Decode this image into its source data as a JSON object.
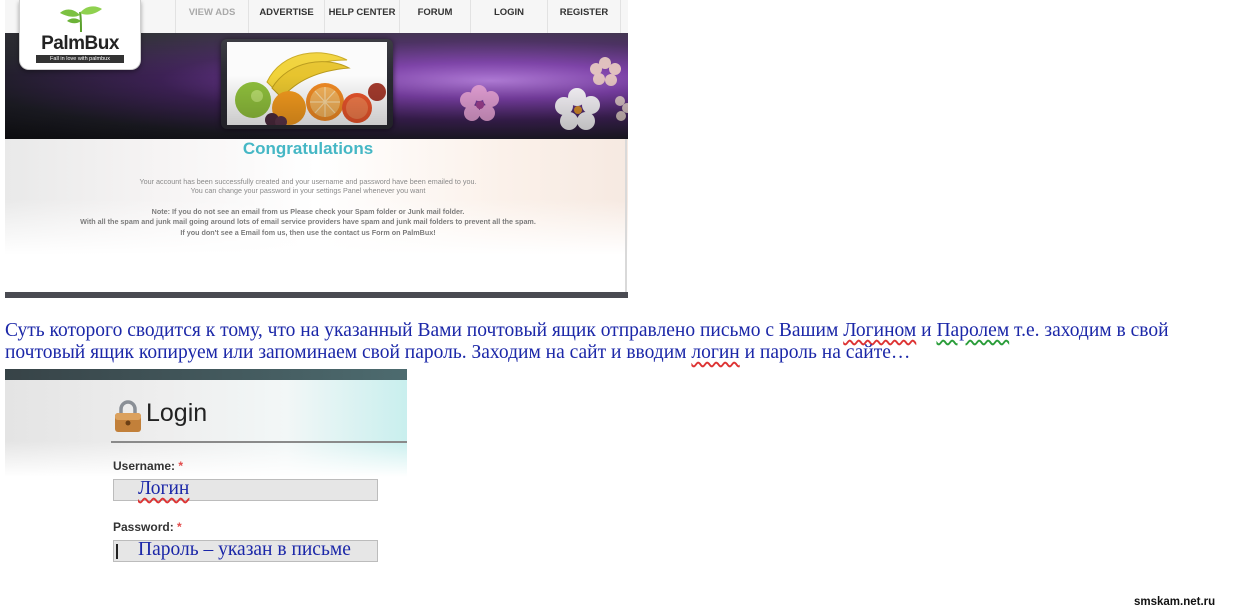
{
  "palmbux": {
    "logo_text": "PalmBux",
    "logo_tagline": "Fall in love with palmbux",
    "nav": [
      {
        "label": "VIEW ADS"
      },
      {
        "label": "ADVERTISE"
      },
      {
        "label": "HELP CENTER"
      },
      {
        "label": "FORUM"
      },
      {
        "label": "LOGIN"
      },
      {
        "label": "REGISTER"
      }
    ],
    "heading": "Congratulations",
    "message_line1": "Your account has been successfully created and your username and password have been emailed to you.",
    "message_line2": "You can change your password in your settings Panel whenever you want",
    "note_line1": "Note: If you do not see an email from us Please check your Spam folder or Junk mail folder.",
    "note_line2": "With all the spam and junk mail going around lots of email service providers have spam and junk mail folders to prevent all the spam.",
    "note_line3": "If you don't see a Email fom us, then use the contact us Form on PalmBux!"
  },
  "paragraph": {
    "part1": "Суть которого сводится к тому, что на указанный Вами почтовый ящик отправлено письмо с Вашим ",
    "word_login": "Логином",
    "part2": " и ",
    "word_password": "Паролем",
    "part3": " т.е. заходим в свой почтовый ящик копируем или запоминаем свой пароль. Заходим на сайт и вводим ",
    "word_login_lower": "логин",
    "part4": " и пароль на сайте…"
  },
  "login_form": {
    "title": "Login",
    "username_label": "Username:",
    "username_value": "Логин",
    "password_label": "Password:",
    "password_value": "Пароль – указан в письме",
    "required_mark": "*"
  },
  "watermark": "smskam.net.ru"
}
